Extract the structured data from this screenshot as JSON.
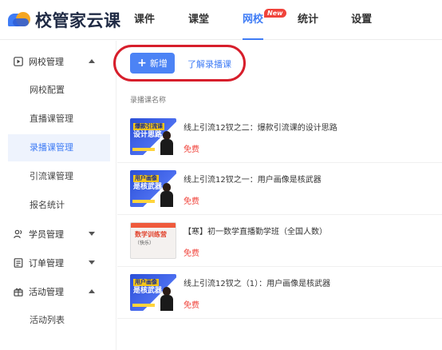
{
  "app": {
    "logo_text": "校管家云课"
  },
  "nav": [
    {
      "label": "课件"
    },
    {
      "label": "课堂"
    },
    {
      "label": "网校",
      "badge": "New"
    },
    {
      "label": "统计"
    },
    {
      "label": "设置"
    }
  ],
  "sidebar": {
    "groups": [
      {
        "label": "网校管理",
        "icon": "play-square-icon",
        "expanded": true,
        "items": [
          "网校配置",
          "直播课管理",
          "录播课管理",
          "引流课管理",
          "报名统计"
        ]
      },
      {
        "label": "学员管理",
        "icon": "users-icon",
        "expanded": false
      },
      {
        "label": "订单管理",
        "icon": "order-list-icon",
        "expanded": false
      },
      {
        "label": "活动管理",
        "icon": "gift-icon",
        "expanded": true,
        "items": [
          "活动列表"
        ]
      }
    ],
    "active_item": "录播课管理"
  },
  "main": {
    "new_button": "新增",
    "learn_link": "了解录播课",
    "column_header": "录播课名称",
    "courses": [
      {
        "title": "线上引流12钗之二：爆款引流课的设计思路",
        "price": "免费",
        "thumb_style": "blue",
        "thumb_tag": "爆款引流课",
        "thumb_text": "设计思路"
      },
      {
        "title": "线上引流12钗之一：用户画像是核武器",
        "price": "免费",
        "thumb_style": "blue",
        "thumb_tag": "用户画像",
        "thumb_text": "是核武器"
      },
      {
        "title": "【寒】初一数学直播勤学班（全国人数）",
        "price": "免费",
        "thumb_style": "red",
        "thumb_tag": "数学训练营",
        "thumb_text": "（快乐）"
      },
      {
        "title": "线上引流12钗之（1）：用户画像是核武器",
        "price": "免费",
        "thumb_style": "blue",
        "thumb_tag": "用户画像",
        "thumb_text": "是核武器"
      }
    ]
  },
  "colors": {
    "accent": "#3f7cf5",
    "badge_red": "#f0433b",
    "highlight_red": "#d71e2b"
  }
}
